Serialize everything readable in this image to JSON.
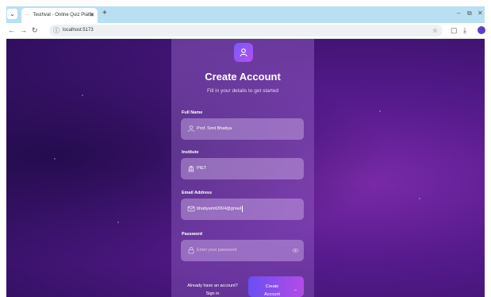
{
  "browser": {
    "tab_title": "Testhvat - Online Quiz Platfo",
    "tab_close": "✕",
    "new_tab": "+",
    "url": "localhost:5173",
    "minimize": "–",
    "restore": "⧉",
    "close": "✕"
  },
  "form": {
    "title": "Create Account",
    "subtitle": "Fill in your details to get started",
    "full_name_label": "Full Name",
    "full_name_value": "Prof. Smit Bhatiya",
    "institute_label": "Institute",
    "institute_value": "PIET",
    "email_label": "Email Address",
    "email_value": "bhatiyamit2004@gmail",
    "password_label": "Password",
    "password_placeholder": "Enter your password",
    "footer_line1": "Already have an account?",
    "footer_line2": "Sign in",
    "create_line1": "Create",
    "create_line2": "Account",
    "create_arrow": "→"
  },
  "colors": {
    "accent_from": "#6a4ff2",
    "accent_to": "#b44be6",
    "tabstrip": "#b8dff2"
  },
  "icons": [
    "tab-menu-icon",
    "back-arrow-icon",
    "forward-arrow-icon",
    "reload-icon",
    "site-info-icon",
    "bookmark-star-icon",
    "downloads-icon",
    "profile-avatar-icon",
    "menu-dots-icon",
    "user-icon",
    "building-icon",
    "mail-icon",
    "lock-icon",
    "eye-icon",
    "logo-user-icon"
  ]
}
